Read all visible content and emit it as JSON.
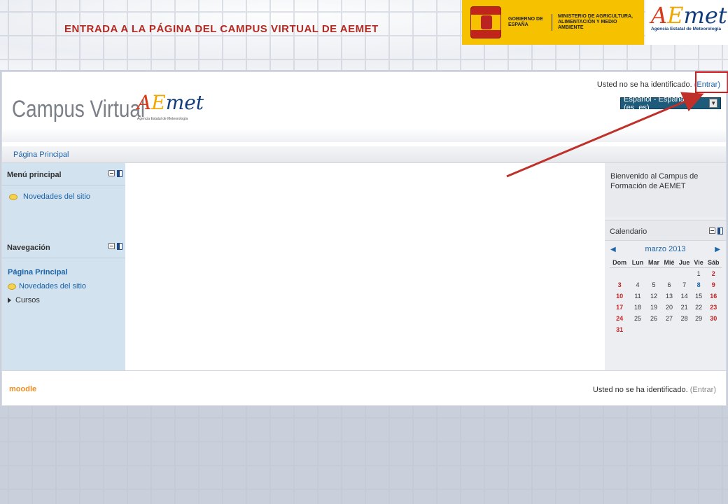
{
  "banner": {
    "title": "ENTRADA A LA PÁGINA DEL CAMPUS VIRTUAL DE AEMET",
    "gov_line1": "GOBIERNO DE ESPAÑA",
    "gov_line2": "MINISTERIO DE AGRICULTURA, ALIMENTACIÓN Y MEDIO AMBIENTE",
    "aemet_sub": "Agencia Estatal de Meteorología"
  },
  "header": {
    "site_title": "Campus Virtual",
    "logo_sub": "Agencia Estatal de Meteorología",
    "login_text": "Usted no se ha identificado.",
    "login_link": "(Entrar)",
    "language": "Español - España (es_es)"
  },
  "navbar": {
    "breadcrumb": "Página Principal"
  },
  "left": {
    "main_menu": {
      "title": "Menú principal",
      "item": "Novedades del sitio"
    },
    "navigation": {
      "title": "Navegación",
      "home": "Página Principal",
      "news": "Novedades del sitio",
      "courses": "Cursos"
    }
  },
  "right": {
    "welcome": "Bienvenido al Campus de Formación de AEMET",
    "calendar": {
      "title": "Calendario",
      "month": "marzo 2013",
      "days": [
        "Dom",
        "Lun",
        "Mar",
        "Mié",
        "Jue",
        "Vie",
        "Sáb"
      ],
      "weeks": [
        [
          "",
          "",
          "",
          "",
          "",
          "1",
          "2"
        ],
        [
          "3",
          "4",
          "5",
          "6",
          "7",
          "8",
          "9"
        ],
        [
          "10",
          "11",
          "12",
          "13",
          "14",
          "15",
          "16"
        ],
        [
          "17",
          "18",
          "19",
          "20",
          "21",
          "22",
          "23"
        ],
        [
          "24",
          "25",
          "26",
          "27",
          "28",
          "29",
          "30"
        ],
        [
          "31",
          "",
          "",
          "",
          "",
          "",
          ""
        ]
      ]
    }
  },
  "footer": {
    "moodle": "moodle",
    "login_text": "Usted no se ha identificado.",
    "login_link": "(Entrar)"
  },
  "colors": {
    "banner_title": "#b42a23",
    "link": "#1d64a8",
    "highlight_box": "#d41a1a",
    "block_bg": "#d2e2ee",
    "gov_yellow": "#f6c200"
  }
}
